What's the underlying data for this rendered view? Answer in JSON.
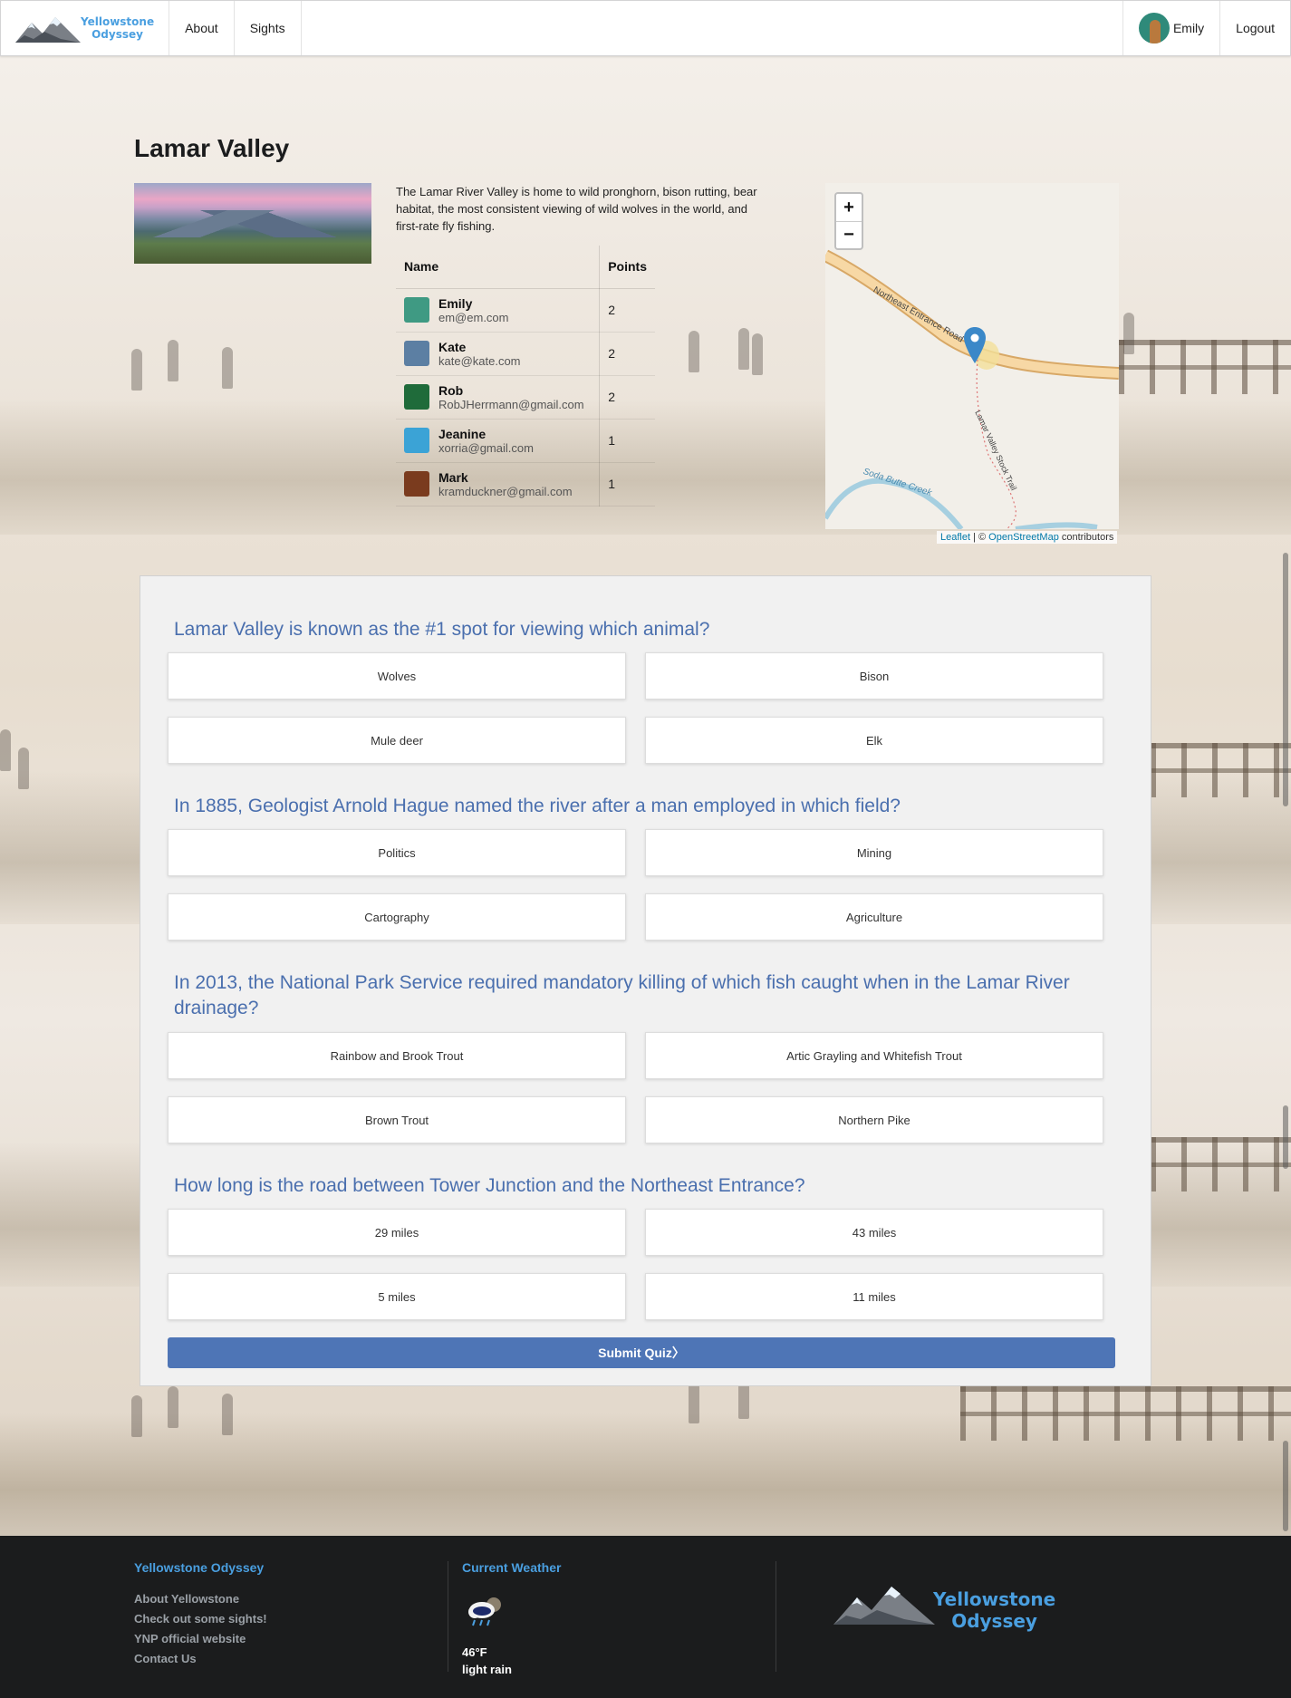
{
  "brand": {
    "line1": "Yellowstone",
    "line2": "Odyssey"
  },
  "nav": {
    "about": "About",
    "sights": "Sights",
    "user": "Emily",
    "logout": "Logout"
  },
  "sight": {
    "title": "Lamar Valley",
    "description": "The Lamar River Valley is home to wild pronghorn, bison rutting, bear habitat, the most consistent viewing of wild wolves in the world, and first-rate fly fishing."
  },
  "leaderboard": {
    "headers": {
      "name": "Name",
      "points": "Points"
    },
    "rows": [
      {
        "name": "Emily",
        "email": "em@em.com",
        "points": "2",
        "avatar_color": "#3f9a83"
      },
      {
        "name": "Kate",
        "email": "kate@kate.com",
        "points": "2",
        "avatar_color": "#5c7fa3"
      },
      {
        "name": "Rob",
        "email": "RobJHerrmann@gmail.com",
        "points": "2",
        "avatar_color": "#1f6b3a"
      },
      {
        "name": "Jeanine",
        "email": "xorria@gmail.com",
        "points": "1",
        "avatar_color": "#3ba3d6"
      },
      {
        "name": "Mark",
        "email": "kramduckner@gmail.com",
        "points": "1",
        "avatar_color": "#7a3b1e"
      }
    ]
  },
  "map": {
    "zoom_in": "+",
    "zoom_out": "−",
    "road_label": "Northeast Entrance Road",
    "trail_label": "Lamar Valley Stock Trail",
    "creek_label": "Soda Butte Creek",
    "attribution_leaflet": "Leaflet",
    "attribution_sep": " | © ",
    "attribution_osm": "OpenStreetMap",
    "attribution_tail": " contributors"
  },
  "quiz": {
    "questions": [
      {
        "text": "Lamar Valley is known as the #1 spot for viewing which animal?",
        "answers": [
          "Wolves",
          "Bison",
          "Mule deer",
          "Elk"
        ]
      },
      {
        "text": "In 1885, Geologist Arnold Hague named the river after a man employed in which field?",
        "answers": [
          "Politics",
          "Mining",
          "Cartography",
          "Agriculture"
        ]
      },
      {
        "text": "In 2013, the National Park Service required mandatory killing of which fish caught when in the Lamar River drainage?",
        "answers": [
          "Rainbow and Brook Trout",
          "Artic Grayling and Whitefish Trout",
          "Brown Trout",
          "Northern Pike"
        ]
      },
      {
        "text": "How long is the road between Tower Junction and the Northeast Entrance?",
        "answers": [
          "29 miles",
          "43 miles",
          "5 miles",
          "11 miles"
        ]
      }
    ],
    "submit": "Submit Quiz〉"
  },
  "footer": {
    "col1_title": "Yellowstone Odyssey",
    "links": [
      "About Yellowstone",
      "Check out some sights!",
      "YNP official website",
      "Contact Us"
    ],
    "col2_title": "Current Weather",
    "weather_icon": "rain-cloud-icon",
    "temp": "46°F",
    "condition": "light rain"
  },
  "colors": {
    "accent": "#4a9fe0",
    "quiz_title": "#4a6fae",
    "submit": "#4e75b6",
    "footer_bg": "#1b1c1d"
  }
}
